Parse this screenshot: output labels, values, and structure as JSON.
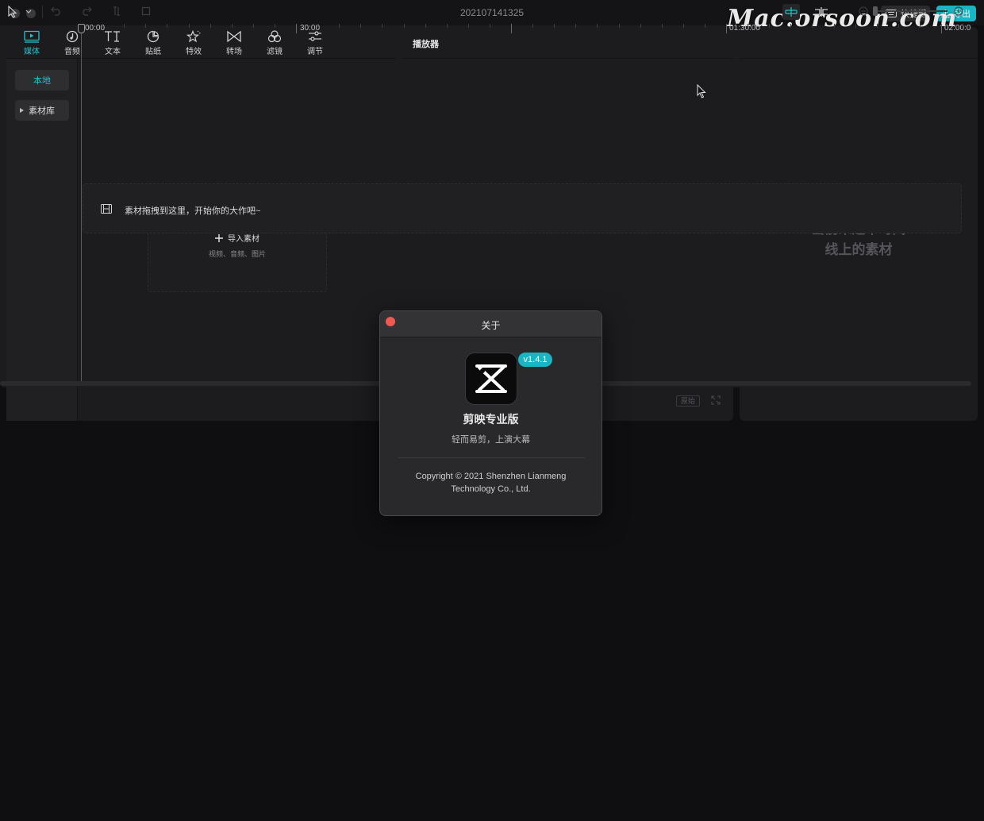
{
  "window": {
    "title": "202107141325",
    "shortcut_label": "快捷键",
    "export_label": "导出",
    "watermark": "Mac.orsoon.com"
  },
  "media_panel": {
    "tabs": [
      {
        "label": "媒体",
        "icon": "media-icon",
        "active": true
      },
      {
        "label": "音频",
        "icon": "audio-icon",
        "active": false
      },
      {
        "label": "文本",
        "icon": "text-icon",
        "active": false
      },
      {
        "label": "贴纸",
        "icon": "sticker-icon",
        "active": false
      },
      {
        "label": "特效",
        "icon": "effects-icon",
        "active": false
      },
      {
        "label": "转场",
        "icon": "transition-icon",
        "active": false
      },
      {
        "label": "滤镜",
        "icon": "filter-icon",
        "active": false
      },
      {
        "label": "调节",
        "icon": "adjust-icon",
        "active": false
      }
    ],
    "sidebar": {
      "local": "本地",
      "library": "素材库"
    },
    "import": {
      "label": "导入素材",
      "hint": "视频、音频、图片"
    }
  },
  "player": {
    "title": "播放器",
    "original_label": "原始"
  },
  "details": {
    "empty_line1": "当前未选中时间",
    "empty_line2": "线上的素材"
  },
  "timeline": {
    "ruler": [
      "00:00",
      "30:00",
      "01:30:00",
      "02:00:0"
    ],
    "drop_hint": "素材拖拽到这里，开始你的大作吧~"
  },
  "about_dialog": {
    "title": "关于",
    "version": "v1.4.1",
    "app_name": "剪映专业版",
    "slogan": "轻而易剪，上演大幕",
    "copyright_line1": "Copyright © 2021 Shenzhen Lianmeng",
    "copyright_line2": "Technology Co., Ltd."
  },
  "colors": {
    "accent": "#22c4d0",
    "close": "#ed5a52",
    "panel": "#1c1c1f"
  }
}
